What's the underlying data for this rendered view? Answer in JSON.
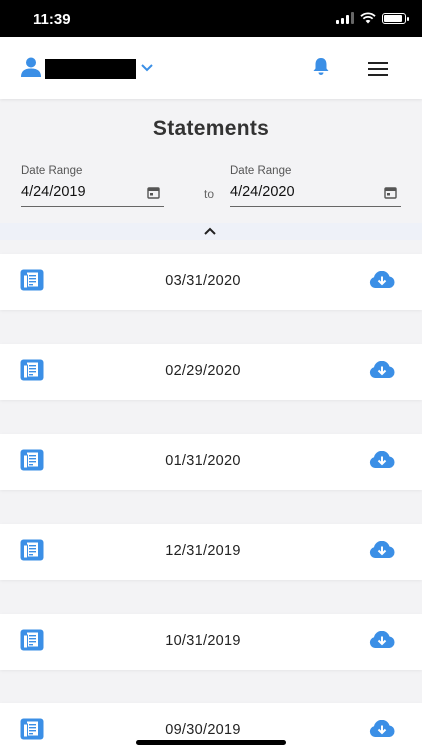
{
  "status_bar": {
    "time": "11:39"
  },
  "header": {
    "user_icon": "person-icon",
    "dropdown_icon": "chevron-down-icon",
    "notification_icon": "bell-icon",
    "menu_icon": "hamburger-menu-icon"
  },
  "page": {
    "title": "Statements"
  },
  "date_range": {
    "from_label": "Date Range",
    "from_value": "4/24/2019",
    "separator": "to",
    "to_label": "Date Range",
    "to_value": "4/24/2020"
  },
  "statements": [
    {
      "date": "03/31/2020"
    },
    {
      "date": "02/29/2020"
    },
    {
      "date": "01/31/2020"
    },
    {
      "date": "12/31/2019"
    },
    {
      "date": "10/31/2019"
    },
    {
      "date": "09/30/2019"
    }
  ],
  "colors": {
    "accent": "#3b8fe6",
    "page_background": "#f3f3f5",
    "collapse_bar": "#eef1f8"
  }
}
